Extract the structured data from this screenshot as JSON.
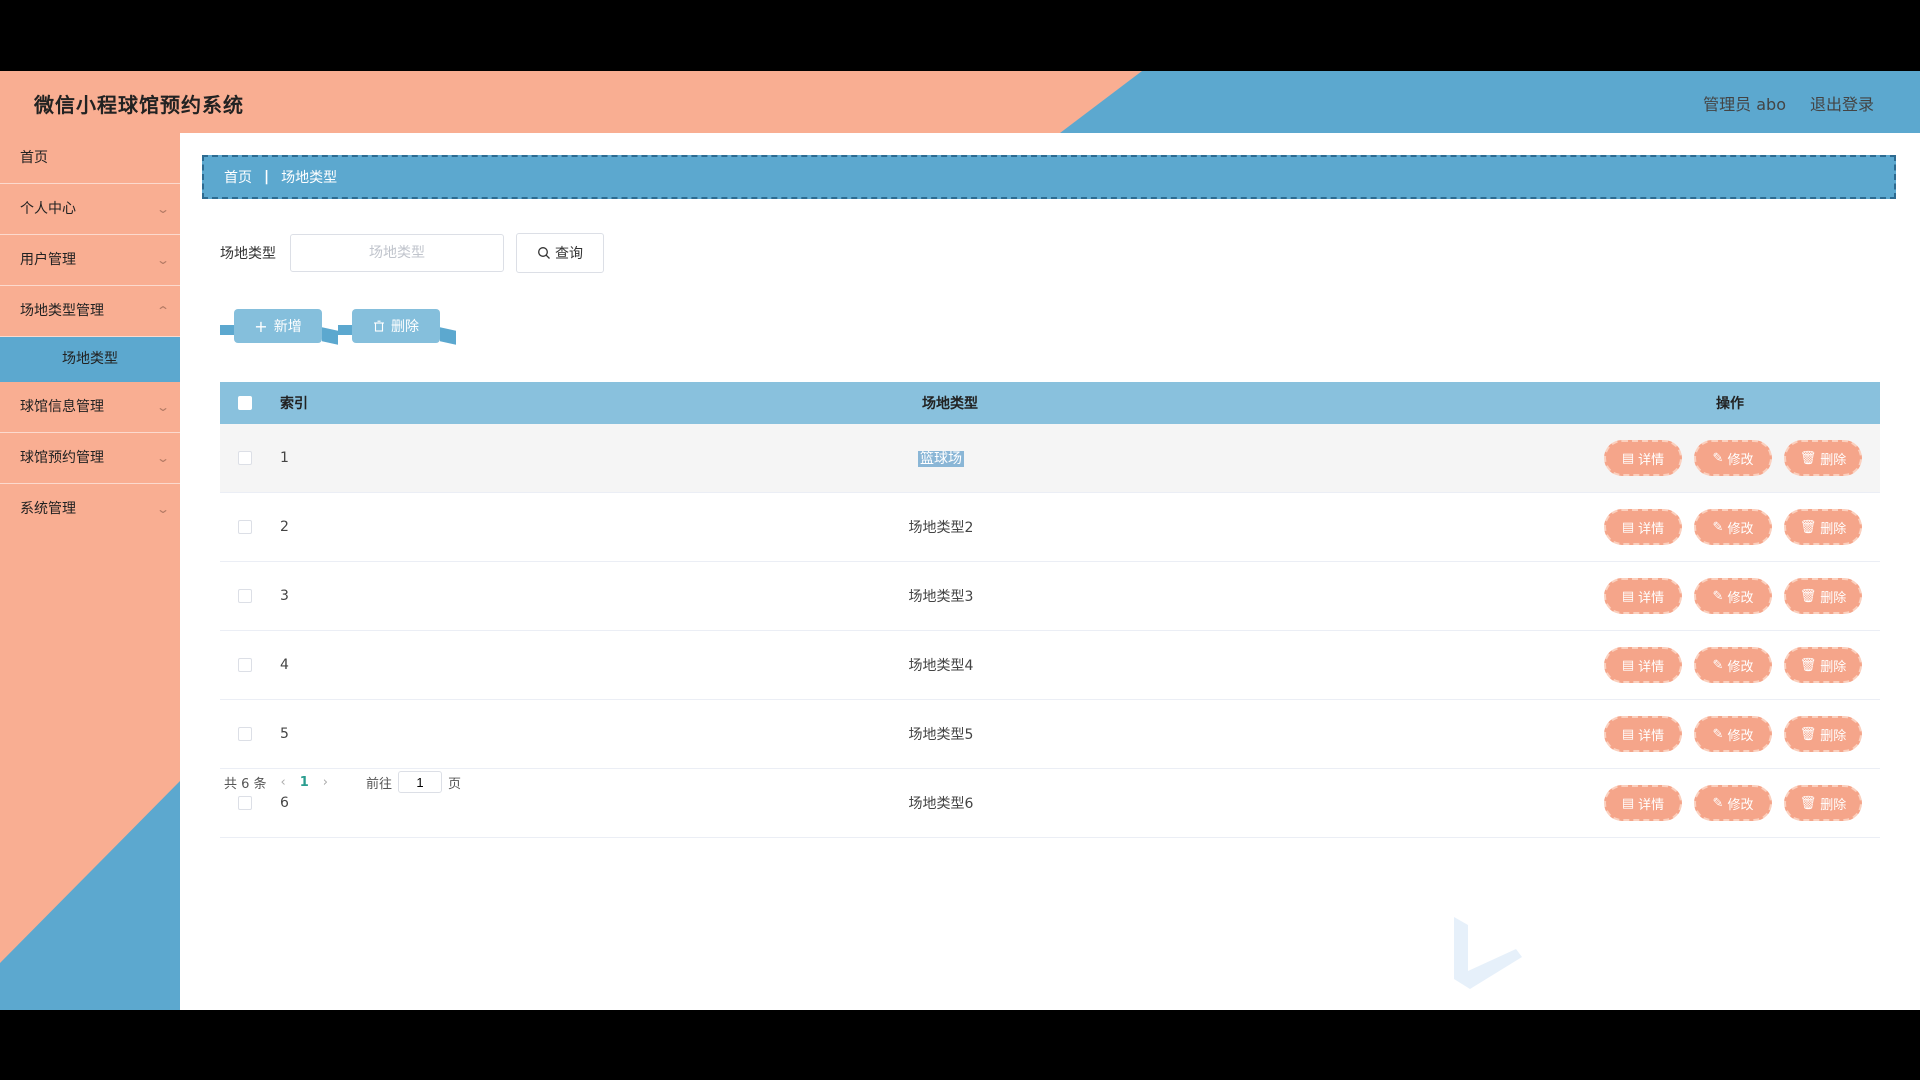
{
  "header": {
    "title": "微信小程球馆预约系统",
    "user_label": "管理员 abo",
    "logout_label": "退出登录"
  },
  "sidebar": {
    "items": [
      {
        "label": "首页",
        "has_children": false
      },
      {
        "label": "个人中心",
        "has_children": true
      },
      {
        "label": "用户管理",
        "has_children": true
      },
      {
        "label": "场地类型管理",
        "has_children": true,
        "expanded": true
      },
      {
        "label": "球馆信息管理",
        "has_children": true
      },
      {
        "label": "球馆预约管理",
        "has_children": true
      },
      {
        "label": "系统管理",
        "has_children": true
      }
    ],
    "active_sub": "场地类型"
  },
  "breadcrumb": {
    "home": "首页",
    "separator": "|",
    "current": "场地类型"
  },
  "search": {
    "label": "场地类型",
    "placeholder": "场地类型",
    "query_label": "查询"
  },
  "actions": {
    "add_label": "新增",
    "delete_label": "删除"
  },
  "table": {
    "headers": {
      "index": "索引",
      "name": "场地类型",
      "ops": "操作"
    },
    "rows": [
      {
        "index": "1",
        "name": "篮球场",
        "selected_text": true
      },
      {
        "index": "2",
        "name": "场地类型2"
      },
      {
        "index": "3",
        "name": "场地类型3"
      },
      {
        "index": "4",
        "name": "场地类型4"
      },
      {
        "index": "5",
        "name": "场地类型5"
      },
      {
        "index": "6",
        "name": "场地类型6"
      }
    ],
    "row_ops": {
      "detail": "详情",
      "edit": "修改",
      "delete": "删除"
    }
  },
  "pagination": {
    "total_label": "共 6 条",
    "current_page": "1",
    "goto_label": "前往",
    "goto_value": "1",
    "page_suffix": "页"
  },
  "colors": {
    "salmon": "#f9ae92",
    "blue": "#5ca8cf",
    "header_blue": "#89c1dd",
    "op_button": "#f5a58a"
  }
}
